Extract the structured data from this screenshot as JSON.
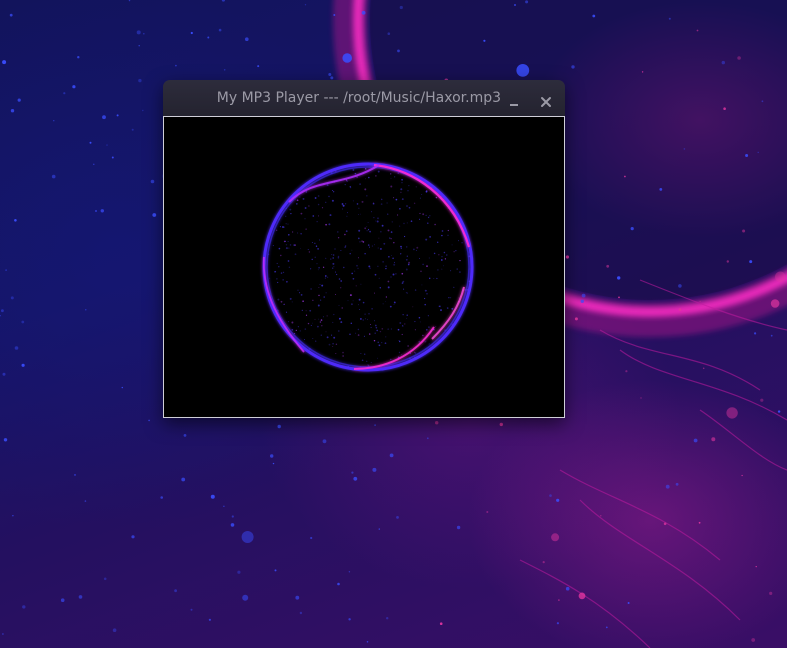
{
  "desktop": {
    "wallpaper_name": "space-nebula-wallpaper"
  },
  "window": {
    "title": "My MP3 Player --- /root/Music/Haxor.mp3",
    "minimize_icon": "minimize-icon",
    "close_icon": "close-icon"
  },
  "visualizer": {
    "style": "circular-waveform",
    "colors": {
      "primary": "#5a35ff",
      "accent": "#ff2bd6",
      "background": "#000000"
    }
  },
  "colors": {
    "titlebar": "#2a2937",
    "title_text": "#9b9aa6",
    "desktop_blue": "#16176a",
    "desktop_magenta": "#d21aa8"
  }
}
